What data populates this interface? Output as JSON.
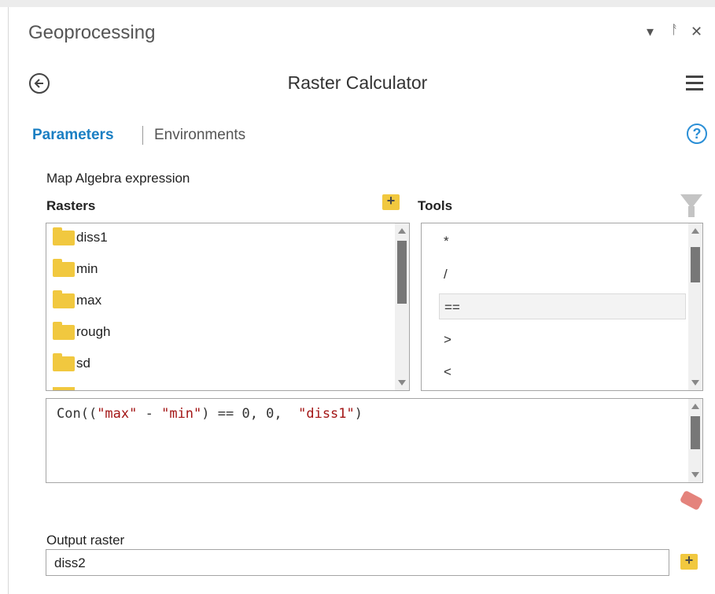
{
  "pane": {
    "title": "Geoprocessing",
    "controls": [
      "▾",
      "ᚨ",
      "✕"
    ]
  },
  "tool": {
    "title": "Raster Calculator"
  },
  "tabs": {
    "parameters": "Parameters",
    "environments": "Environments"
  },
  "help_label": "?",
  "map_algebra": {
    "label": "Map Algebra expression",
    "rasters_header": "Rasters",
    "tools_header": "Tools",
    "rasters": [
      "diss1",
      "min",
      "max",
      "rough",
      "sd"
    ],
    "tools": [
      "*",
      "/",
      "==",
      ">",
      "<"
    ],
    "selected_tool": "==",
    "expression": {
      "p1": "Con((",
      "s1": "\"max\"",
      "p2": " - ",
      "s2": "\"min\"",
      "p3": ") == 0, 0,  ",
      "s3": "\"diss1\"",
      "p4": ")"
    }
  },
  "output": {
    "label": "Output raster",
    "value": "diss2"
  },
  "icons": {
    "add": "+",
    "folder_color": "#f1c83f",
    "accent_color": "#1a7fc3"
  }
}
